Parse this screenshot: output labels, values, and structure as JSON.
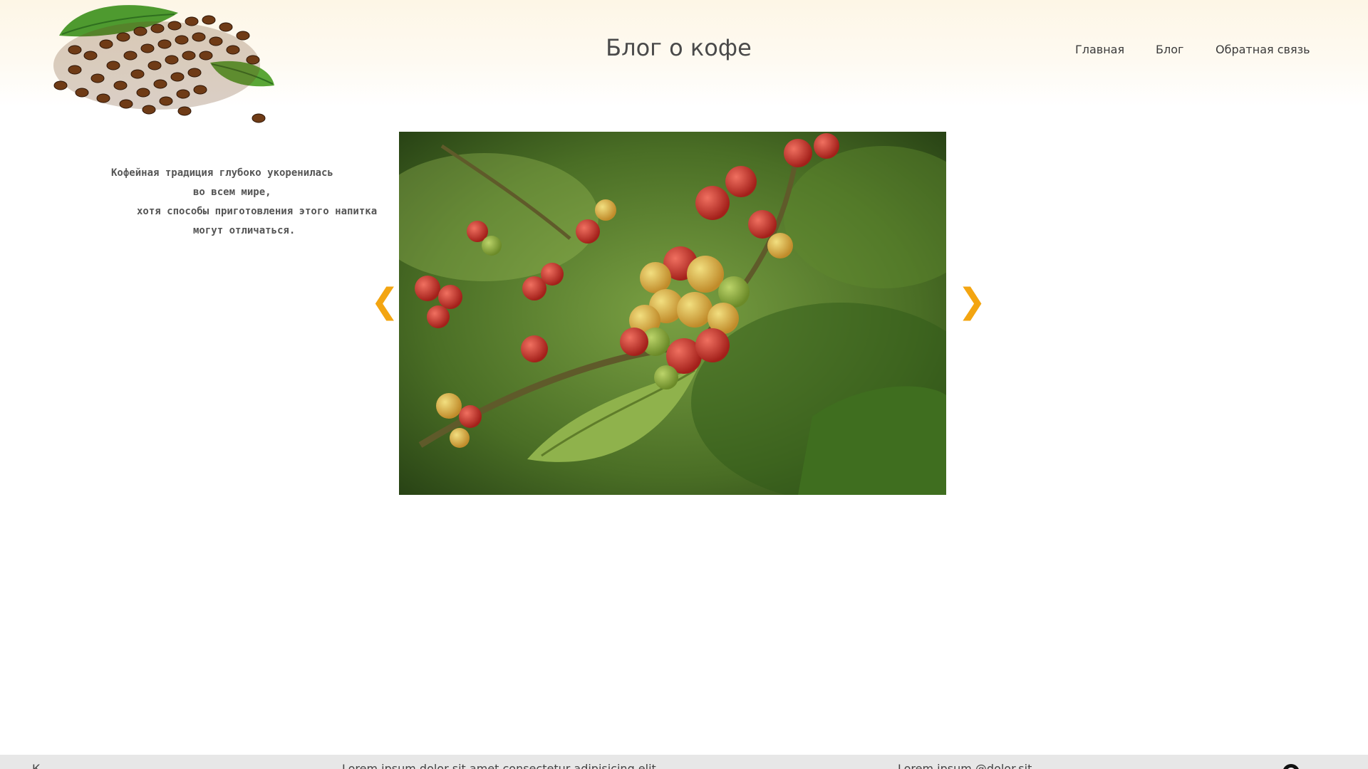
{
  "header": {
    "site_title": "Блог о кофе",
    "logo_icon": "coffee-beans-logo"
  },
  "nav": {
    "items": [
      {
        "label": "Главная"
      },
      {
        "label": "Блог"
      },
      {
        "label": "Обратная связь"
      }
    ]
  },
  "intro": {
    "lines": [
      "Кофейная традиция глубоко укоренилась",
      "во всем мире,",
      "хотя способы приготовления этого напитка",
      "могут отличаться."
    ]
  },
  "slider": {
    "image_icon": "coffee-berries-photo",
    "prev_label": "❮",
    "next_label": "❯"
  },
  "footer": {
    "left_text": "К",
    "middle_text": "Lorem ipsum dolor sit amet consectetur adipisicing elit",
    "right_text": "Lorem ipsum @dolor.sit",
    "icon": "github-icon"
  },
  "colors": {
    "accent": "#f3a511",
    "footer_bg": "#e7e7e7",
    "header_bg": "#fdf6e6"
  }
}
